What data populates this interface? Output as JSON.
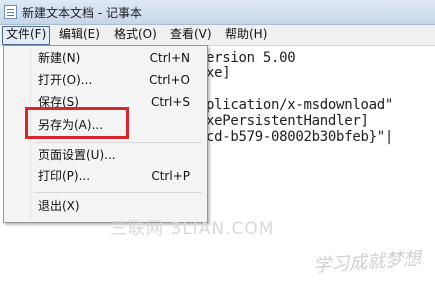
{
  "window": {
    "title": "新建文本文档 - 记事本"
  },
  "menubar": [
    {
      "label": "文件(F)"
    },
    {
      "label": "编辑(E)"
    },
    {
      "label": "格式(O)"
    },
    {
      "label": "查看(V)"
    },
    {
      "label": "帮助(H)"
    }
  ],
  "file_menu": {
    "items": [
      {
        "label": "新建(N)",
        "shortcut": "Ctrl+N"
      },
      {
        "label": "打开(O)...",
        "shortcut": "Ctrl+O"
      },
      {
        "label": "保存(S)",
        "shortcut": "Ctrl+S"
      },
      {
        "label": "另存为(A)...",
        "shortcut": ""
      },
      {
        "label": "页面设置(U)...",
        "shortcut": ""
      },
      {
        "label": "打印(P)...",
        "shortcut": "Ctrl+P"
      },
      {
        "label": "退出(X)",
        "shortcut": ""
      }
    ],
    "highlighted": "另存为(A)...",
    "highlight_color": "#d9262c"
  },
  "editor": {
    "lines": [
      "ersion 5.00",
      "xe]",
      "",
      "plication/x-msdownload\"",
      "xePersistentHandler]",
      "cd-b579-08002b30bfeb}\"|"
    ]
  },
  "watermarks": {
    "site": "三联网 3LIAN.COM",
    "signature": "学习成就梦想"
  }
}
